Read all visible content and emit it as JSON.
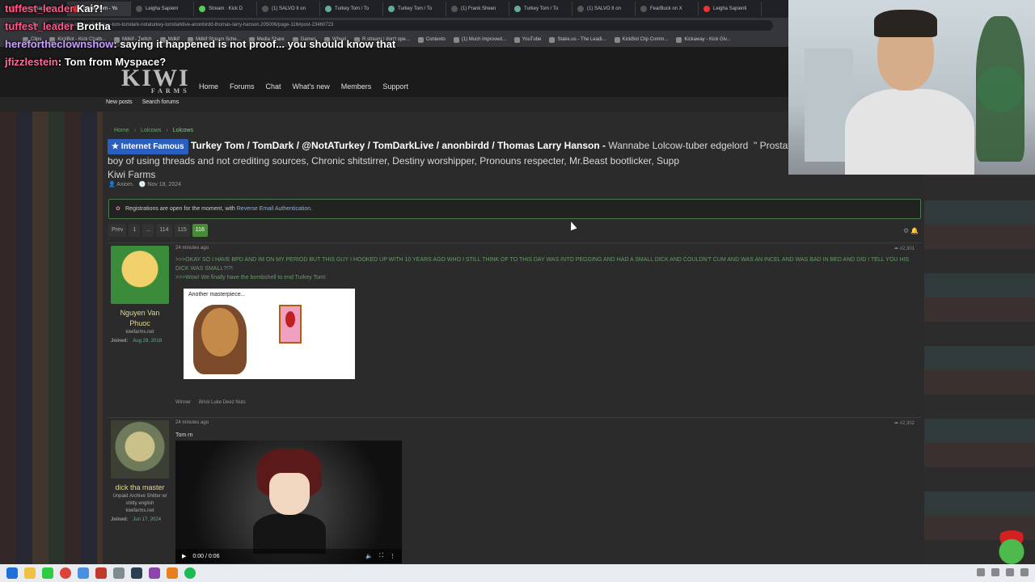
{
  "browser": {
    "tabs": [
      {
        "label": "Leigha Sapienti",
        "color": "#e33"
      },
      {
        "label": "Turkey Tom - Yo",
        "color": "#e33"
      },
      {
        "label": "Leigha Sapient",
        "color": "#555"
      },
      {
        "label": "Stream · Kick D",
        "color": "#5c5"
      },
      {
        "label": "(1) SALVO II on",
        "color": "#555"
      },
      {
        "label": "Turkey Tom / To",
        "color": "#6a9"
      },
      {
        "label": "Turkey Tom / To",
        "color": "#6a9"
      },
      {
        "label": "(1) Frank Sheen",
        "color": "#555"
      },
      {
        "label": "Turkey Tom / To",
        "color": "#6a9"
      },
      {
        "label": "(1) SALVO II on",
        "color": "#555"
      },
      {
        "label": "FearBuck on X",
        "color": "#555"
      },
      {
        "label": "Leigha Sapienti",
        "color": "#e33"
      }
    ],
    "url": "kiwifarms.st/threads/turkey-tom-tomdark-notaturkey-tomdarklive-anonbirdd-thomas-larry-hanson.205006/page-116#post-23460723",
    "bookmarks": [
      "Clips",
      "KickBot - Kick Chatb...",
      "Mdkif - Twitch",
      "Mdkif",
      "Mdkif Stream Sche...",
      "Media Share",
      "Games",
      "Wheel",
      "R.stream | don't ope...",
      "Contexto",
      "(1) Much improved...",
      "YouTube",
      "Stake.us - The Leadi...",
      "KickBot Clip Comm...",
      "Kickaway - Kick Giv..."
    ]
  },
  "site": {
    "logo_main": "KIWI",
    "logo_sub": "FARMS",
    "nav": [
      "Home",
      "Forums",
      "Chat",
      "What's new",
      "Members",
      "Support"
    ],
    "subnav": [
      "New posts",
      "Search forums"
    ]
  },
  "thread": {
    "breadcrumbs": [
      "Home",
      "Lolcows",
      "Lolcows"
    ],
    "badge": "Internet Famous",
    "title_bold": "Turkey Tom / TomDark / @NotATurkey / TomDarkLive / anonbirdd / Thomas Larry Hanson -",
    "title_desc": "Wannabe Lolcow-tuber edgelord  \" Prostate,\" Poster boy of using threads and not crediting sources, Chronic shitstirrer, Destiny worshipper, Pronouns respecter, Mr.Beast bootlicker, Supp",
    "title_tail": "Kiwi Farms",
    "author": "Axiom.",
    "date": "Nov 18, 2024",
    "notice_text": "Registrations are open for the moment, with",
    "notice_link": "Reverse Email Authentication",
    "pages": [
      "Prev",
      "1",
      "...",
      "114",
      "115",
      "116"
    ]
  },
  "posts": [
    {
      "username": "Nguyen Van Phuoc",
      "user_title": "kiwifarms.net",
      "joined_label": "Joined:",
      "joined_date": "Aug 28, 2018",
      "time": "24 minutes ago",
      "number": "#2,301",
      "greentext_1": ">>>OKAY SO I HAVE BPD AND IM ON MY PERIOD BUT THIS GUY I HOOKED UP WITH 10 YEARS AGO WHO I STILL THINK OF TO THIS DAY WAS INTO PEGGING AND HAD A SMALL DICK AND COULDN'T CUM AND WAS AN INCEL AND WAS BAD IN BED AND DID I TELL YOU HIS DICK WAS SMALL?!?!",
      "greentext_2": ">>>Wow! We finally have the bombshell to end Turkey Tom!",
      "meme_caption": "Another masterpiece...",
      "reactions": [
        "Winner",
        "Brick Luke Deez Nuts"
      ]
    },
    {
      "username": "dick tha master",
      "user_title": "Unpaid Archive Shitter w/ shitty english",
      "user_site": "kiwifarms.net",
      "joined_label": "Joined:",
      "joined_date": "Jun 17, 2024",
      "time": "24 minutes ago",
      "number": "#2,302",
      "text": "Tom rn",
      "video_time": "0:00 / 0:06"
    }
  ],
  "chat": [
    {
      "user": "tuffest_leader",
      "msg": "Kai?!"
    },
    {
      "user": "tuffest_leader",
      "msg": "Brotha"
    },
    {
      "user": "herefortheclownshow",
      "msg": "saying it happened is not proof... you should know that"
    },
    {
      "user": "jfizzlestein",
      "msg": "Tom from Myspace?"
    }
  ]
}
